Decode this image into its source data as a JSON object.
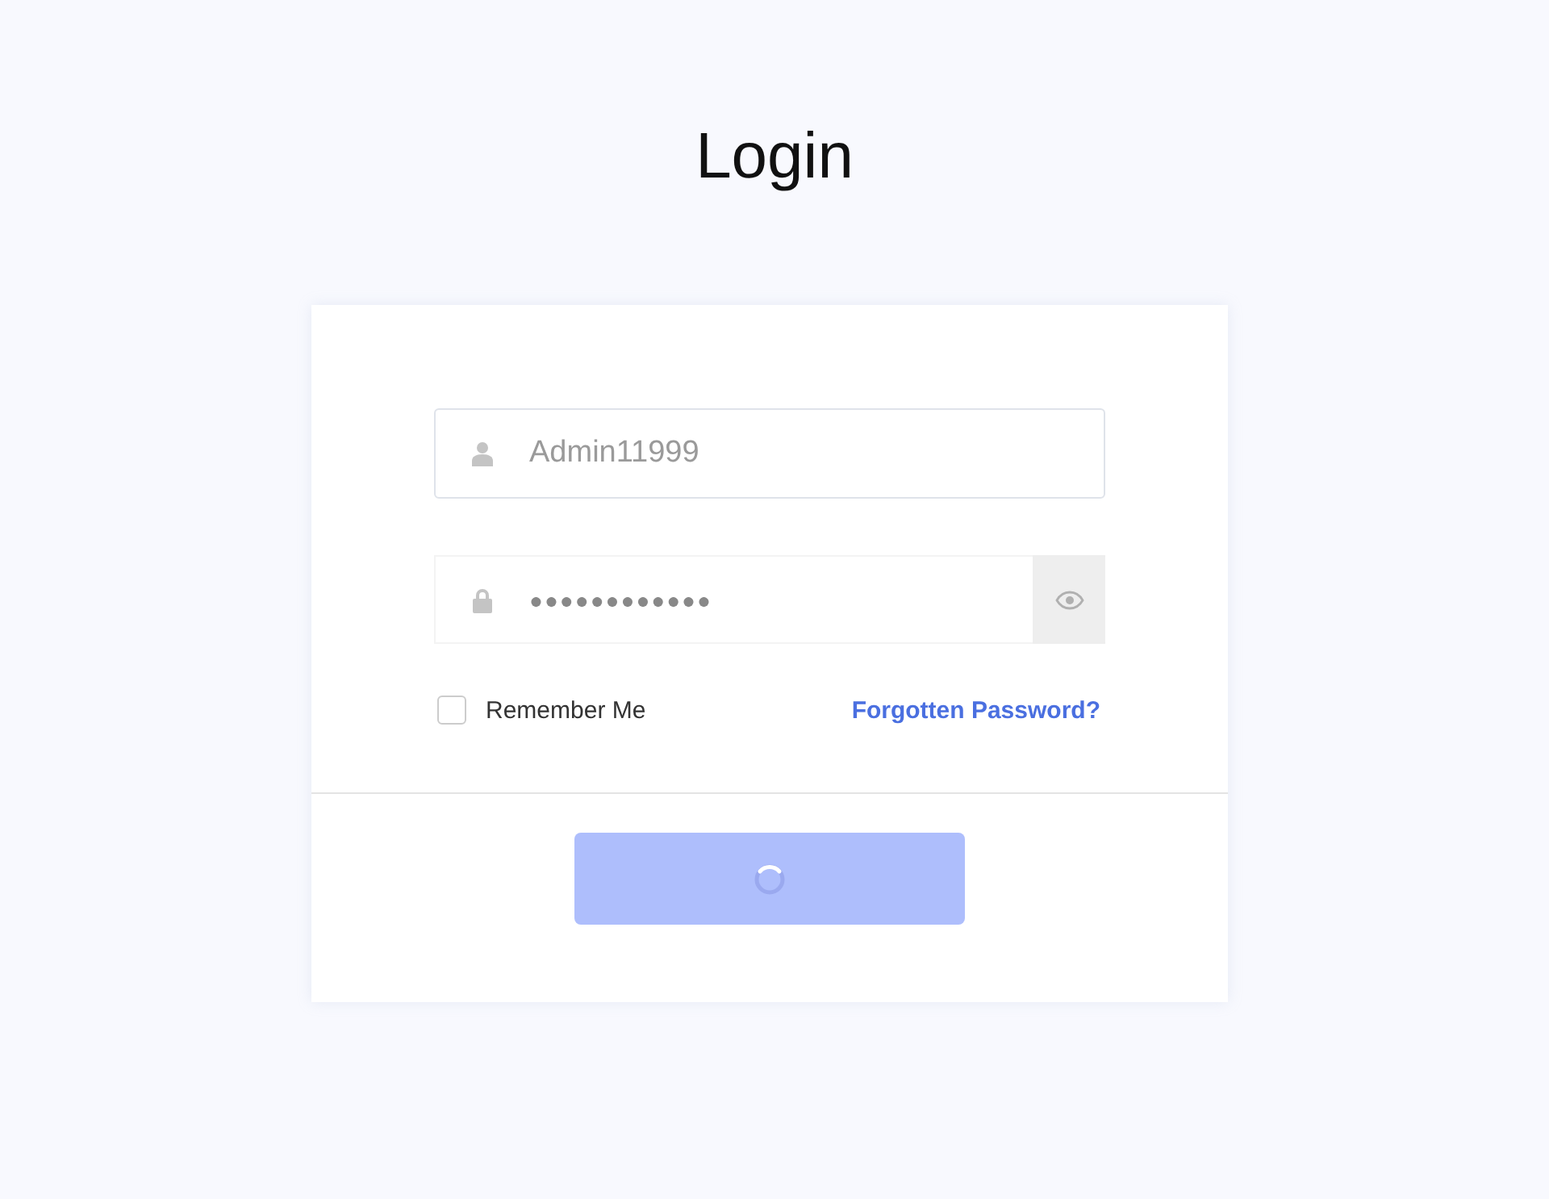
{
  "title": "Login",
  "username": {
    "value": "Admin11999"
  },
  "password": {
    "value": "●●●●●●●●●●●●"
  },
  "remember": {
    "label": "Remember Me",
    "checked": false
  },
  "forgot_link": "Forgotten Password?",
  "submit": {
    "loading": true
  }
}
